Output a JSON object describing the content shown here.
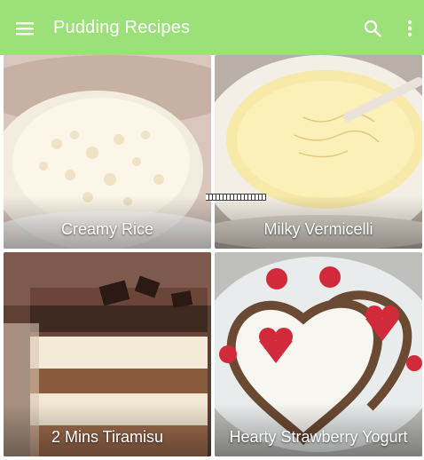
{
  "appbar": {
    "title": "Pudding Recipes",
    "color": "#9ce07a",
    "icons": {
      "menu": "menu-icon",
      "search": "search-icon",
      "more": "more-vert-icon"
    }
  },
  "recipes": [
    {
      "label": "Creamy Rice"
    },
    {
      "label": "Milky Vermicelli"
    },
    {
      "label": "2 Mins Tiramisu"
    },
    {
      "label": "Hearty Strawberry Yogurt"
    }
  ]
}
